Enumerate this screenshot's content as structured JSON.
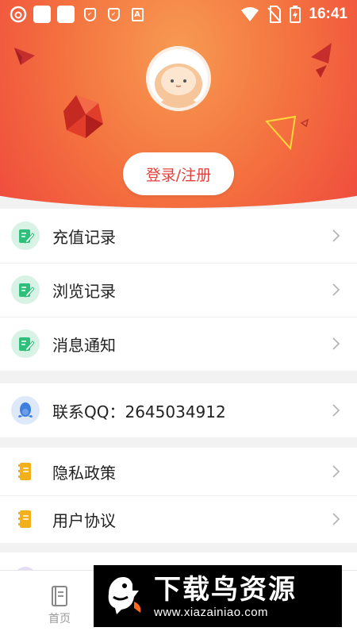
{
  "status_bar": {
    "time": "16:41",
    "left_icons": [
      "netease-music-icon",
      "app-square-icon",
      "app-square-icon",
      "shield-icon",
      "shield-icon",
      "a-badge-icon"
    ],
    "right_icons": [
      "wifi-icon",
      "no-sim-icon",
      "battery-charging-icon"
    ]
  },
  "profile": {
    "avatar_icon": "cartoon-avatar-icon",
    "login_label": "登录/注册"
  },
  "groups": [
    {
      "items": [
        {
          "label": "充值记录",
          "icon": "notepad-edit-icon"
        },
        {
          "label": "浏览记录",
          "icon": "notepad-edit-icon"
        },
        {
          "label": "消息通知",
          "icon": "notepad-edit-icon"
        }
      ]
    },
    {
      "items": [
        {
          "label": "联系QQ：2645034912",
          "icon": "qq-penguin-icon"
        }
      ]
    },
    {
      "items": [
        {
          "label": "隐私政策",
          "icon": "document-icon"
        },
        {
          "label": "用户协议",
          "icon": "document-icon"
        }
      ]
    }
  ],
  "tabbar": {
    "home_label": "首页"
  },
  "watermark": {
    "title": "下载鸟资源",
    "url": "www.xiazainiao.com"
  },
  "colors": {
    "header_red": "#ec3e3d",
    "header_orange": "#f79a52",
    "accent_green": "#2fbf7a",
    "icon_blue": "#3d7ee0",
    "icon_yellow": "#f2b01c",
    "login_text": "#e2423e"
  }
}
